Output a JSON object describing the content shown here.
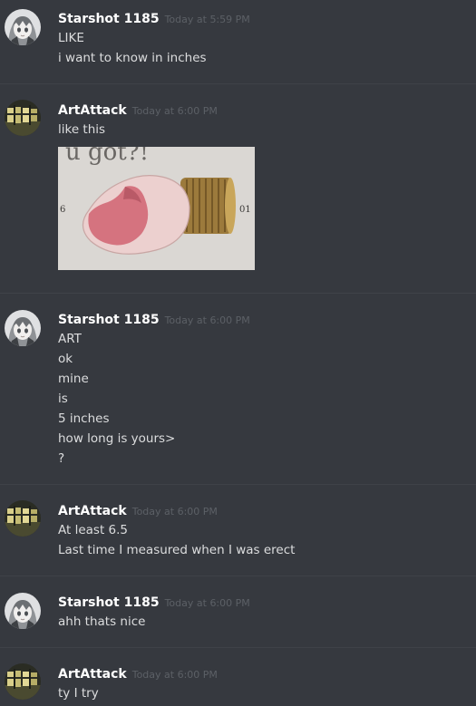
{
  "messages": [
    {
      "author": "Starshot 1185",
      "time": "Today at 5:59 PM",
      "avatar_icon": "anime-girl-avatar-icon",
      "lines": [
        "LIKE",
        "i want to know in inches"
      ]
    },
    {
      "author": "ArtAttack",
      "time": "Today at 6:00 PM",
      "avatar_icon": "building-avatar-icon",
      "lines": [
        "like this"
      ],
      "attachment": {
        "icon": "meme-image",
        "caption": "u got?!",
        "left_mark": "6",
        "right_mark": "01"
      }
    },
    {
      "author": "Starshot 1185",
      "time": "Today at 6:00 PM",
      "avatar_icon": "anime-girl-avatar-icon",
      "lines": [
        "ART",
        "ok",
        "mine",
        "is",
        "5 inches",
        "how long is yours>",
        "?"
      ]
    },
    {
      "author": "ArtAttack",
      "time": "Today at 6:00 PM",
      "avatar_icon": "building-avatar-icon",
      "lines": [
        "At least 6.5",
        "Last time I measured when I was erect"
      ]
    },
    {
      "author": "Starshot 1185",
      "time": "Today at 6:00 PM",
      "avatar_icon": "anime-girl-avatar-icon",
      "lines": [
        "ahh thats nice"
      ]
    },
    {
      "author": "ArtAttack",
      "time": "Today at 6:00 PM",
      "avatar_icon": "building-avatar-icon",
      "lines": [
        "ty I try"
      ]
    }
  ],
  "colors": {
    "background": "#36393f",
    "username": "#ffffff",
    "timestamp": "#5c6066",
    "text": "#dcddde"
  }
}
